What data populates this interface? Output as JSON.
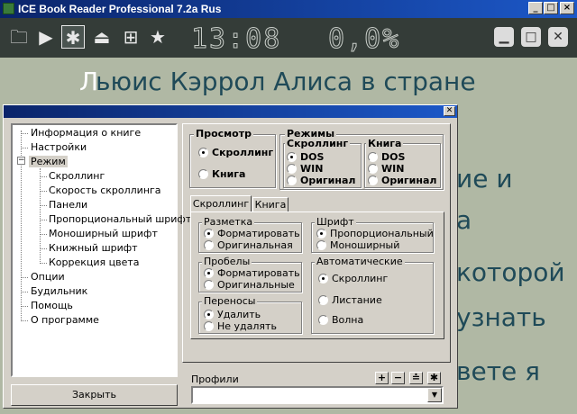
{
  "window": {
    "title": "ICE Book Reader Professional 7.2a Rus"
  },
  "toolbar": {
    "clock": "13:08",
    "progress": "0,0%",
    "icons": [
      "folder-icon",
      "play-icon",
      "settings-icon",
      "eject-icon",
      "add-icon",
      "star-icon"
    ]
  },
  "reader": {
    "line1_first": "Л",
    "line1_rest": "ьюис  Кэррол  Алиса  в  стране",
    "line2": "ие     и",
    "line3": "а",
    "line4": "которой",
    "line5": "узнать",
    "line6": "вете    я"
  },
  "tree": {
    "items": [
      "Информация о книге",
      "Настройки",
      "Режим",
      "Скроллинг",
      "Скорость скроллинга",
      "Панели",
      "Пропорциональный шрифт",
      "Моноширный шрифт",
      "Книжный шрифт",
      "Коррекция цвета",
      "Опции",
      "Будильник",
      "Помощь",
      "О программе"
    ],
    "expander": "−"
  },
  "close_button": "Закрыть",
  "view": {
    "title": "Просмотр",
    "options": [
      "Скроллинг",
      "Книга"
    ],
    "selected": 0
  },
  "modes": {
    "title": "Режимы",
    "scrolling": {
      "title": "Скроллинг",
      "options": [
        "DOS",
        "WIN",
        "Оригинал"
      ],
      "selected": 0
    },
    "book": {
      "title": "Книга",
      "options": [
        "DOS",
        "WIN",
        "Оригинал"
      ],
      "selected": 0
    }
  },
  "tabs": [
    "Скроллинг",
    "Книга"
  ],
  "layout_group": {
    "title": "Разметка",
    "options": [
      "Форматировать",
      "Оригинальная"
    ],
    "selected": 0
  },
  "font_group": {
    "title": "Шрифт",
    "options": [
      "Пропорциональный",
      "Моноширный"
    ],
    "selected": 0
  },
  "spaces_group": {
    "title": "Пробелы",
    "options": [
      "Форматировать",
      "Оригинальные"
    ],
    "selected": 0
  },
  "auto_group": {
    "title": "Автоматические",
    "options": [
      "Скроллинг",
      "Листание",
      "Волна"
    ],
    "selected": 0
  },
  "hyphen_group": {
    "title": "Переносы",
    "options": [
      "Удалить",
      "Не удалять"
    ],
    "selected": 0
  },
  "profiles": {
    "label": "Профили",
    "value": ""
  },
  "profile_buttons": [
    "+",
    "−",
    "≐",
    "✱"
  ]
}
